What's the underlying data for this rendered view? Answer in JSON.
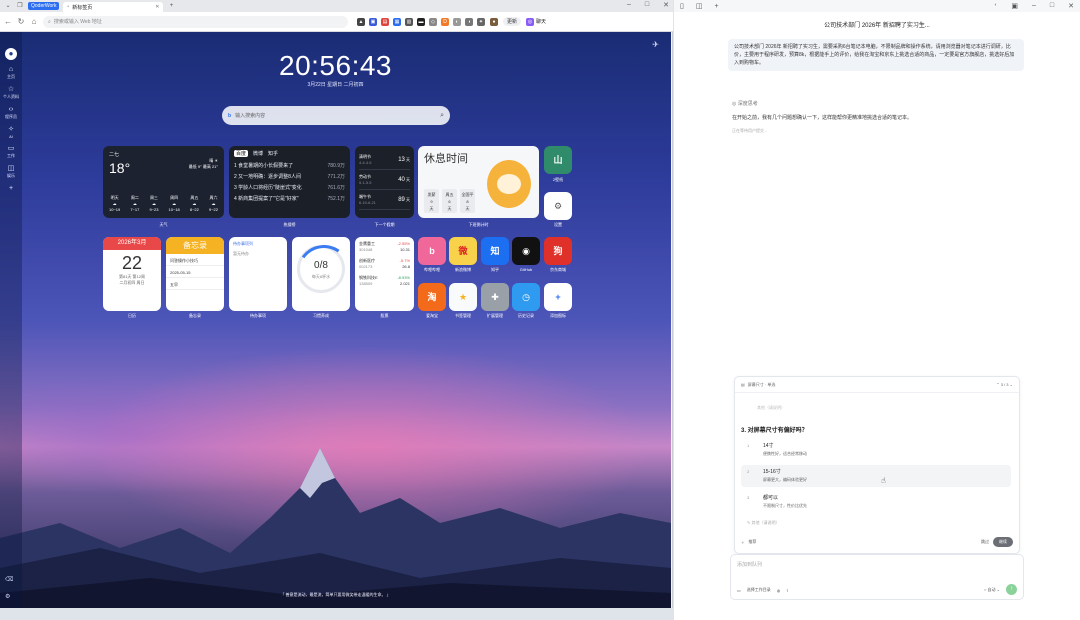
{
  "browser": {
    "brand_pill": "QoderWork",
    "tab_title": "新标签页",
    "address_placeholder": "搜索或输入 Web 地址",
    "update_label": "更新",
    "chat_label": "聊天"
  },
  "newtab": {
    "clock": "20:56:43",
    "date": "3月22日  星期日  二月初四",
    "search_placeholder": "输入搜索内容",
    "sidebar": [
      "主页",
      "个人资料",
      "程序员",
      "AI",
      "工作",
      "娱乐"
    ],
    "weather": {
      "city": "二七",
      "temp": "18°",
      "cond": "晴",
      "range": "最低 9° 最高 21°",
      "days": [
        "明天",
        "周二",
        "周三",
        "周四",
        "周五",
        "周六"
      ],
      "ranges": [
        "10~19",
        "7~17",
        "9~23",
        "10~18",
        "8~22",
        "9~22"
      ],
      "label": "天气"
    },
    "hot": {
      "tabs": [
        "百度",
        "微博",
        "知乎"
      ],
      "items": [
        {
          "t": "1 食堂暑期的小长假要来了",
          "n": "780.9万"
        },
        {
          "t": "2 又一地明确：逐步调整8人间",
          "n": "771.2万"
        },
        {
          "t": "3 学龄人口将经历\"陡崖式\"变化",
          "n": "761.6万"
        },
        {
          "t": "4 新商集团提案了\"它是\"好家\"",
          "n": "752.1万"
        }
      ],
      "label": "热搜榜"
    },
    "festivals": {
      "items": [
        {
          "n": "清明节",
          "d": "4.4-4.6",
          "v": "13"
        },
        {
          "n": "劳动节",
          "d": "5.1-5.5",
          "v": "40"
        },
        {
          "n": "端午节",
          "d": "6.19-6.21",
          "v": "89"
        }
      ],
      "unit": "天",
      "label": "下一个假期"
    },
    "rest": {
      "title": "休息时间",
      "days": [
        {
          "a": "发薪",
          "b": "9",
          "c": "天"
        },
        {
          "a": "周五",
          "b": "6",
          "c": "天"
        },
        {
          "a": "全国平",
          "b": "8",
          "c": "天"
        }
      ],
      "label": "下班倒计时"
    },
    "apps_top": [
      {
        "name": "2壁纸",
        "color": "#2f8b6a",
        "glyph": "山"
      },
      {
        "name": "设置",
        "color": "#ffffff",
        "glyph": "⚙"
      }
    ],
    "calendar": {
      "head": "2026年3月",
      "day": "22",
      "sub1": "第81天 第12周",
      "sub2": "二月初四 周日",
      "label": "日历"
    },
    "memo": {
      "head": "备忘录",
      "lines": [
        "问答操作小技巧",
        "2025-05-15",
        "五早"
      ],
      "label": "备忘录"
    },
    "todo": {
      "title": "待办事项列",
      "sub": "暂无待办",
      "label": "待办事项"
    },
    "habit": {
      "value": "0/8",
      "sub": "每天8杯水",
      "label": "习惯养成"
    },
    "stocks": {
      "items": [
        {
          "n": "金鹰重工",
          "c": "301048",
          "p": "-2.55%",
          "v": "10.31",
          "up": false
        },
        {
          "n": "创新医疗",
          "c": "002173",
          "p": "-5.7%",
          "v": "26.8",
          "up": false
        },
        {
          "n": "钢铁科技E",
          "c": "138509",
          "p": "-8.93%",
          "v": "2.021",
          "up": true
        }
      ],
      "label": "股票"
    },
    "apps_row1": [
      {
        "name": "哔哩哔哩",
        "color": "#f0679a",
        "glyph": "b"
      },
      {
        "name": "新浪微博",
        "color": "#f7d24a",
        "glyph": "微"
      },
      {
        "name": "知乎",
        "color": "#1d6ff2",
        "glyph": "知"
      },
      {
        "name": "GitHub",
        "color": "#111111",
        "glyph": "◉"
      },
      {
        "name": "京东商城",
        "color": "#e0302a",
        "glyph": "狗"
      }
    ],
    "apps_row2": [
      {
        "name": "爱淘宝",
        "color": "#f46a1b",
        "glyph": "淘"
      },
      {
        "name": "书签管理",
        "color": "#f8fafc",
        "glyph": "★"
      },
      {
        "name": "扩展管理",
        "color": "#9aa0a8",
        "glyph": "✚"
      },
      {
        "name": "历史记录",
        "color": "#2e9af0",
        "glyph": "◷"
      },
      {
        "name": "添加图标",
        "color": "#ffffff",
        "glyph": "+"
      }
    ],
    "quote": "「 善意是流动，最是流，简单只要用微笑带走温暖的生命。 」"
  },
  "chat": {
    "title": "公司技术部门 2026年 新招聘了实习生...",
    "user_msg": "公司技术部门 2026年 新招聘了实习生，需要采购6台笔记本电脑，不限制品牌和操作系统，请用浏览器对笔记本进行调研，比价，主要用于程序研发，预算8k，根据能手上的评价，给我在淘宝和京东上挑选合适的商品，一定要是官方旗舰店，挑选好后加入到购物车。",
    "thinking": "深度思考",
    "answer": "在开始之前，我有几个问题想确认一下，这样能帮你更精准地挑选合适的笔记本。",
    "answer2": "正在等待用户提交...",
    "panel_head": "屏幕尺寸 · 单选",
    "page": "3 / 3",
    "faded": "其他（请说明）",
    "question": "3. 对屏幕尺寸有偏好吗？",
    "options": [
      {
        "no": "1",
        "t": "14寸",
        "d": "便携性好，适合经常移动"
      },
      {
        "no": "2",
        "t": "15-16寸",
        "d": "屏幕更大，编码体验更好"
      },
      {
        "no": "3",
        "t": "都可以",
        "d": "不限制尺寸，性价比优先"
      }
    ],
    "other": "其他（请说明）",
    "recommend": "推荐",
    "skip": "跳过",
    "continue": "继续",
    "input_placeholder": "添加到队列",
    "workdir": "选择工作目录",
    "mode": "自动"
  }
}
